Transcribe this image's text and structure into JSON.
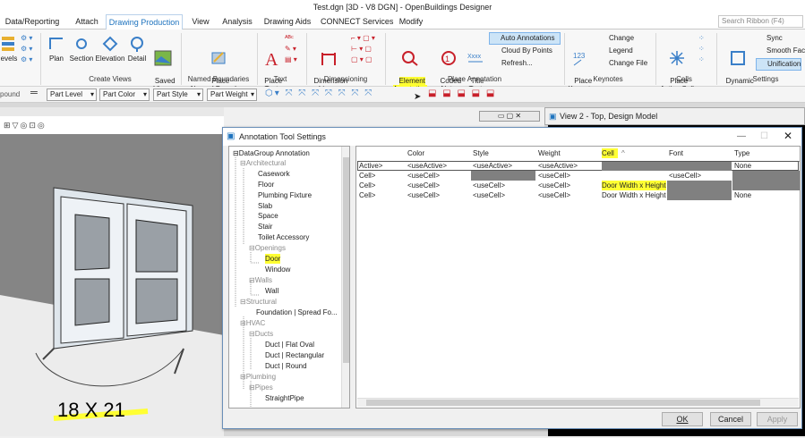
{
  "window": {
    "title": "Test.dgn [3D - V8 DGN] - OpenBuildings Designer"
  },
  "tabs": [
    "Data/Reporting",
    "Attach",
    "Drawing Production",
    "View",
    "Analysis",
    "Drawing Aids",
    "CONNECT Services",
    "Modify"
  ],
  "search_placeholder": "Search Ribbon (F4)",
  "ribbon": {
    "levels": "evels",
    "plan": "Plan",
    "section": "Section",
    "elevation": "Elevation",
    "detail": "Detail",
    "saved_views": "Saved\nViews",
    "create_views": "Create Views",
    "place_named_boundary": "Place\nNamed Boundary",
    "named_boundaries": "Named Boundaries",
    "place_text": "Place\nText",
    "text": "Text",
    "dimension_linear": "Dimension\nLinear",
    "dimensioning": "Dimensioning",
    "element_annotation": "Element\nAnnotation",
    "coded_note": "Coded\nNote",
    "title_text": "Title\nText",
    "auto_annotations": "Auto Annotations",
    "cloud_by_points": "Cloud By Points",
    "refresh": "Refresh...",
    "place_annotation": "Place Annotation",
    "place_keynote": "Place\nKeynote",
    "change": "Change",
    "legend": "Legend",
    "change_file": "Change File",
    "keynotes": "Keynotes",
    "place_active_cell": "Place\nActive Cell",
    "cells": "Cells",
    "dynamic": "Dynamic",
    "sync": "Sync",
    "smooth_face": "Smooth Fac",
    "unification": "Unification",
    "settings": "Settings"
  },
  "toolbar2": {
    "pound": "pound",
    "part_level": "Part Level",
    "part_color": "Part Color",
    "part_style": "Part Style",
    "part_weight": "Part Weight"
  },
  "view2_title": "View 2 - Top, Design Model",
  "canvas_text": "18 X 21",
  "dialog": {
    "title": "Annotation Tool Settings",
    "tree": [
      {
        "label": "DataGroup Annotation",
        "grey": false
      },
      {
        "label": "Architectural",
        "grey": true
      },
      {
        "label": "Casework",
        "grey": false
      },
      {
        "label": "Floor",
        "grey": false
      },
      {
        "label": "Plumbing Fixture",
        "grey": false
      },
      {
        "label": "Slab",
        "grey": false
      },
      {
        "label": "Space",
        "grey": false
      },
      {
        "label": "Stair",
        "grey": false
      },
      {
        "label": "Toilet Accessory",
        "grey": false
      },
      {
        "label": "Openings",
        "grey": true
      },
      {
        "label": "Door",
        "grey": false
      },
      {
        "label": "Window",
        "grey": false
      },
      {
        "label": "Walls",
        "grey": true
      },
      {
        "label": "Wall",
        "grey": false
      },
      {
        "label": "Structural",
        "grey": true
      },
      {
        "label": "Foundation | Spread Fo...",
        "grey": false
      },
      {
        "label": "HVAC",
        "grey": true
      },
      {
        "label": "Ducts",
        "grey": true
      },
      {
        "label": "Duct | Flat Oval",
        "grey": false
      },
      {
        "label": "Duct | Rectangular",
        "grey": false
      },
      {
        "label": "Duct | Round",
        "grey": false
      },
      {
        "label": "Plumbing",
        "grey": true
      },
      {
        "label": "Pipes",
        "grey": true
      },
      {
        "label": "StraightPipe",
        "grey": false
      }
    ],
    "columns": [
      "Color",
      "Style",
      "Weight",
      "Cell",
      "Font",
      "Type"
    ],
    "rows": [
      [
        "Active>",
        "<useActive>",
        "<useActive>",
        "<useActive>",
        "",
        "",
        "None"
      ],
      [
        "Cell>",
        "<useCell>",
        "",
        "<useCell>",
        "",
        "<useCell>",
        ""
      ],
      [
        "Cell>",
        "<useCell>",
        "<useCell>",
        "<useCell>",
        "Door Width x Height",
        "",
        ""
      ],
      [
        "Cell>",
        "<useCell>",
        "<useCell>",
        "<useCell>",
        "Door Width x Height",
        "",
        "None"
      ]
    ],
    "ok": "OK",
    "cancel": "Cancel",
    "apply": "Apply"
  }
}
